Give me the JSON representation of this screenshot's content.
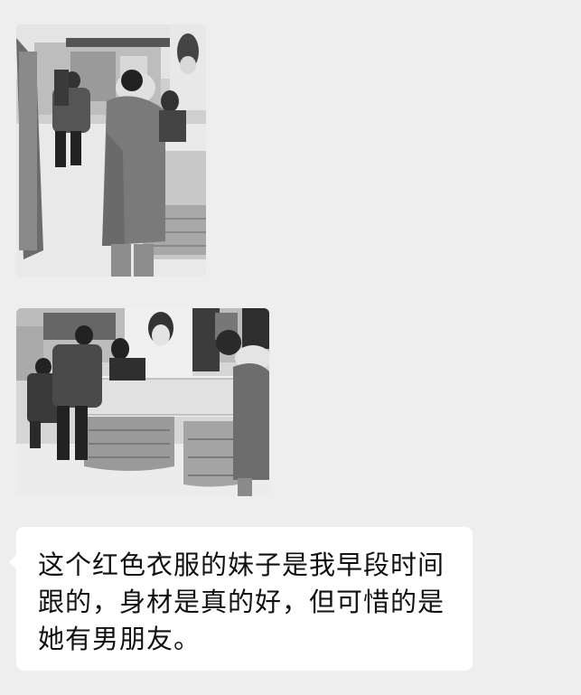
{
  "chat": {
    "messages": [
      {
        "type": "image",
        "description_icon": "photo-jewelry-store-1"
      },
      {
        "type": "image",
        "description_icon": "photo-jewelry-store-2"
      },
      {
        "type": "text",
        "text": "这个红色衣服的妹子是我早段时间跟的，身材是真的好，但可惜的是她有男朋友。"
      }
    ]
  },
  "colors": {
    "background": "#eeeeee",
    "bubble": "#ffffff",
    "text": "#111111"
  }
}
